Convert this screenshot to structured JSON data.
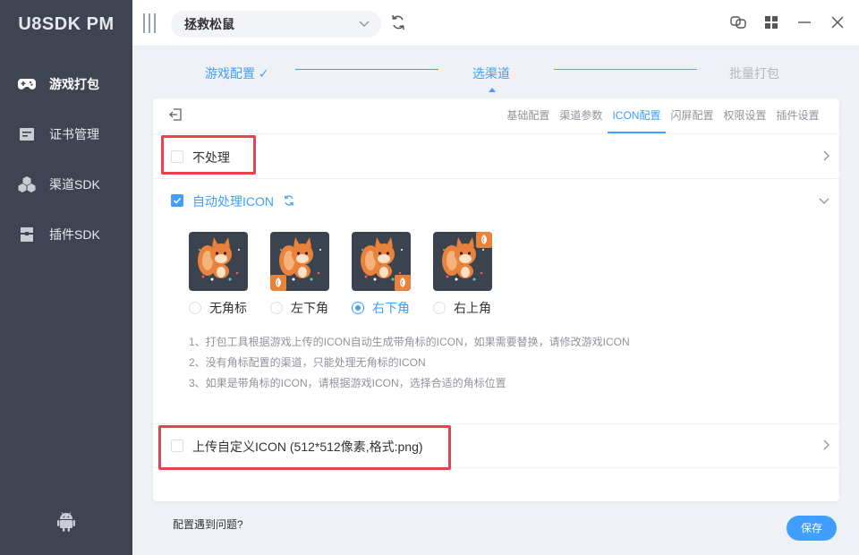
{
  "app": {
    "title": "U8SDK PM"
  },
  "sidebar": {
    "items": [
      {
        "label": "游戏打包",
        "icon": "gamepad-icon",
        "active": true
      },
      {
        "label": "证书管理",
        "icon": "certificate-icon",
        "active": false
      },
      {
        "label": "渠道SDK",
        "icon": "cubes-icon",
        "active": false
      },
      {
        "label": "插件SDK",
        "icon": "plugin-icon",
        "active": false
      }
    ],
    "footer_icon": "android-icon"
  },
  "topbar": {
    "selected_game": "拯救松鼠",
    "colors": {
      "accent": "#409eff"
    }
  },
  "steps": [
    {
      "label": "游戏配置 ✓",
      "state": "done"
    },
    {
      "label": "选渠道",
      "state": "current"
    },
    {
      "label": "批量打包",
      "state": "pending"
    }
  ],
  "tabs": [
    {
      "label": "基础配置",
      "active": false
    },
    {
      "label": "渠道参数",
      "active": false
    },
    {
      "label": "ICON配置",
      "active": true
    },
    {
      "label": "闪屏配置",
      "active": false
    },
    {
      "label": "权限设置",
      "active": false
    },
    {
      "label": "插件设置",
      "active": false
    }
  ],
  "options": {
    "no_process": {
      "label": "不处理",
      "checked": false
    },
    "auto_process": {
      "label": "自动处理ICON",
      "checked": true
    },
    "custom_upload": {
      "label": "上传自定义ICON (512*512像素,格式:png)",
      "checked": false
    }
  },
  "corner_choices": [
    {
      "label": "无角标",
      "selected": false,
      "badge": "none"
    },
    {
      "label": "左下角",
      "selected": false,
      "badge": "bottom-left"
    },
    {
      "label": "右下角",
      "selected": true,
      "badge": "bottom-right"
    },
    {
      "label": "右上角",
      "selected": false,
      "badge": "top-right"
    }
  ],
  "notes": [
    "1、打包工具根据游戏上传的ICON自动生成带角标的ICON，如果需要替换，请修改游戏ICON",
    "2、没有角标配置的渠道，只能处理无角标的ICON",
    "3、如果是带角标的ICON，请根据游戏ICON，选择合适的角标位置"
  ],
  "footer": {
    "help_link": "配置遇到问题?",
    "save_label": "保存"
  }
}
